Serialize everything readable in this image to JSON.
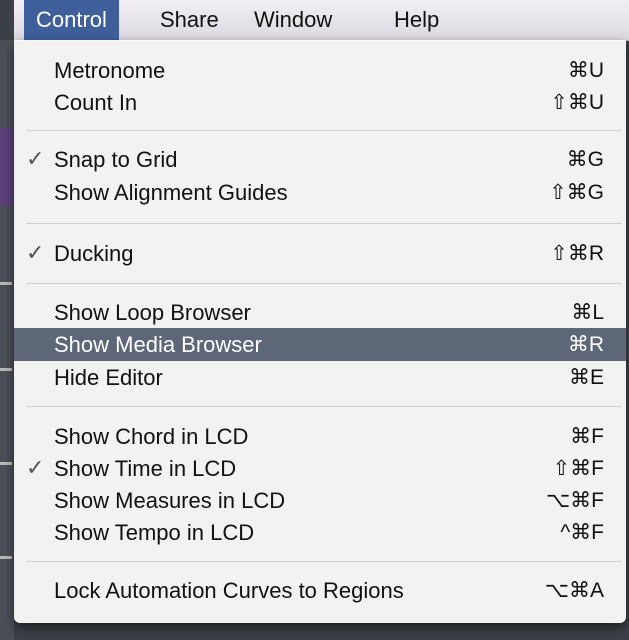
{
  "menubar": {
    "items": [
      {
        "label": "Control",
        "active": true
      },
      {
        "label": "Share"
      },
      {
        "label": "Window"
      },
      {
        "label": "Help"
      }
    ]
  },
  "menu": {
    "items": [
      {
        "label": "Metronome",
        "shortcut": "⌘U",
        "checked": false
      },
      {
        "label": "Count In",
        "shortcut": "⇧⌘U",
        "checked": false
      },
      {
        "label": "Snap to Grid",
        "shortcut": "⌘G",
        "checked": true
      },
      {
        "label": "Show Alignment Guides",
        "shortcut": "⇧⌘G",
        "checked": false
      },
      {
        "label": "Ducking",
        "shortcut": "⇧⌘R",
        "checked": true
      },
      {
        "label": "Show Loop Browser",
        "shortcut": "⌘L",
        "checked": false
      },
      {
        "label": "Show Media Browser",
        "shortcut": "⌘R",
        "checked": false,
        "highlighted": true
      },
      {
        "label": "Hide Editor",
        "shortcut": "⌘E",
        "checked": false
      },
      {
        "label": "Show Chord in LCD",
        "shortcut": "⌘F",
        "checked": false
      },
      {
        "label": "Show Time in LCD",
        "shortcut": "⇧⌘F",
        "checked": true
      },
      {
        "label": "Show Measures in LCD",
        "shortcut": "⌥⌘F",
        "checked": false
      },
      {
        "label": "Show Tempo in LCD",
        "shortcut": "^⌘F",
        "checked": false
      },
      {
        "label": "Lock Automation Curves to Regions",
        "shortcut": "⌥⌘A",
        "checked": false
      }
    ],
    "check_glyph": "✓"
  },
  "colors": {
    "highlight": "#5e6777",
    "menubar_active": "#3f5f9b"
  }
}
